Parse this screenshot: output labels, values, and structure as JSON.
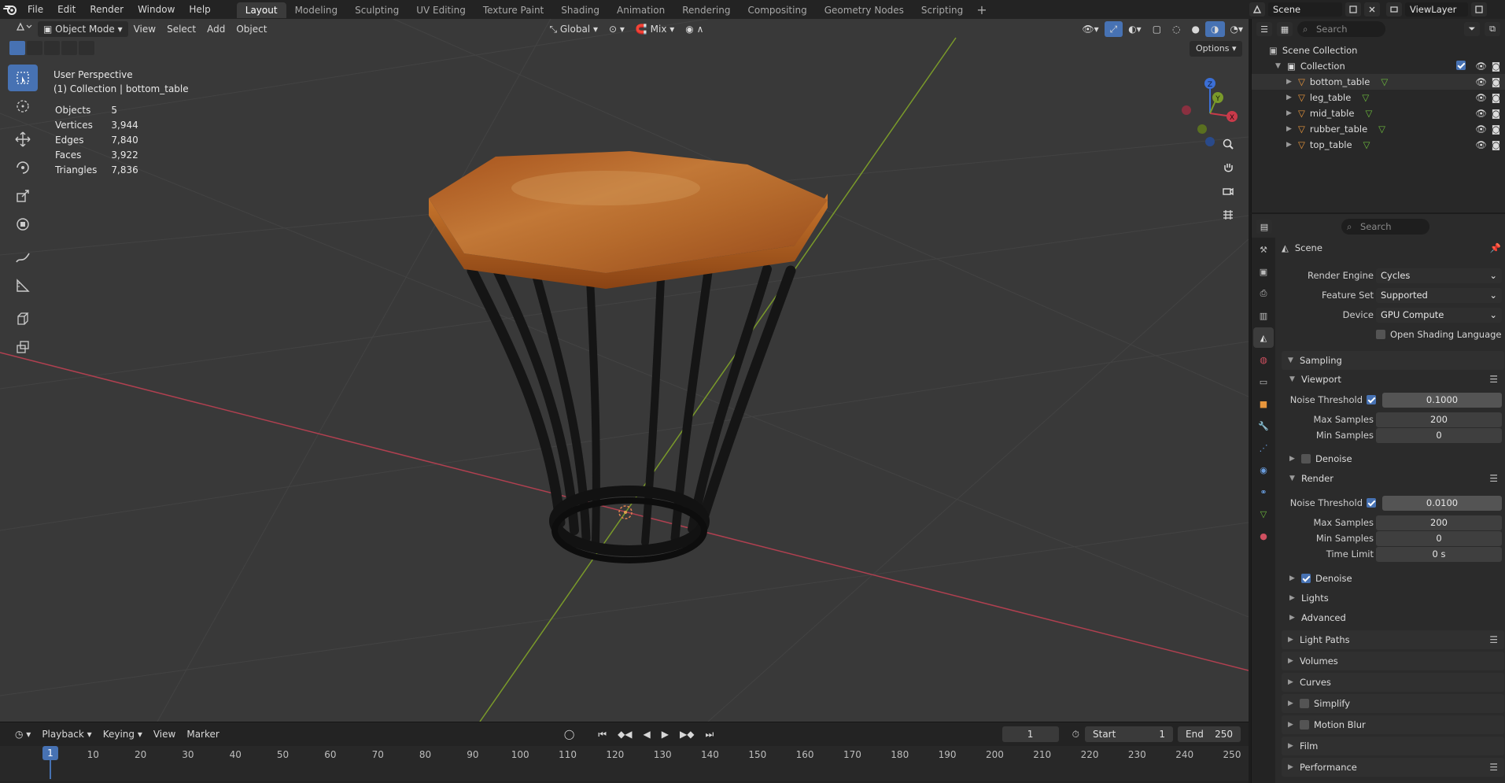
{
  "menu": {
    "items": [
      "File",
      "Edit",
      "Render",
      "Window",
      "Help"
    ]
  },
  "workspaces": {
    "tabs": [
      "Layout",
      "Modeling",
      "Sculpting",
      "UV Editing",
      "Texture Paint",
      "Shading",
      "Animation",
      "Rendering",
      "Compositing",
      "Geometry Nodes",
      "Scripting"
    ],
    "active": "Layout",
    "add": "+"
  },
  "scene": {
    "label": "Scene"
  },
  "viewlayer": {
    "label": "ViewLayer"
  },
  "viewport": {
    "mode": "Object Mode",
    "menus": [
      "View",
      "Select",
      "Add",
      "Object"
    ],
    "orientation": "Global",
    "pivot": "Mix",
    "options": "Options",
    "perspective": "User Perspective",
    "context": "(1) Collection | bottom_table",
    "stats": [
      {
        "label": "Objects",
        "value": "5"
      },
      {
        "label": "Vertices",
        "value": "3,944"
      },
      {
        "label": "Edges",
        "value": "7,840"
      },
      {
        "label": "Faces",
        "value": "3,922"
      },
      {
        "label": "Triangles",
        "value": "7,836"
      }
    ],
    "gizmo": {
      "x": "X",
      "y": "Y",
      "z": "Z"
    }
  },
  "timeline": {
    "menus": [
      "Playback",
      "Keying",
      "View",
      "Marker"
    ],
    "current_frame": "1",
    "start_label": "Start",
    "start": "1",
    "end_label": "End",
    "end": "250",
    "ticks": [
      "1",
      "10",
      "20",
      "30",
      "40",
      "50",
      "60",
      "70",
      "80",
      "90",
      "100",
      "110",
      "120",
      "130",
      "140",
      "150",
      "160",
      "170",
      "180",
      "190",
      "200",
      "210",
      "220",
      "230",
      "240",
      "250"
    ]
  },
  "outliner": {
    "search_placeholder": "Search",
    "scene_collection": "Scene Collection",
    "collection": "Collection",
    "objects": [
      "bottom_table",
      "leg_table",
      "mid_table",
      "rubber_table",
      "top_table"
    ]
  },
  "properties": {
    "search_placeholder": "Search",
    "context": "Scene",
    "render_engine_label": "Render Engine",
    "render_engine": "Cycles",
    "feature_set_label": "Feature Set",
    "feature_set": "Supported",
    "device_label": "Device",
    "device": "GPU Compute",
    "osl_label": "Open Shading Language",
    "sampling": "Sampling",
    "viewport_sub": "Viewport",
    "noise_threshold_label": "Noise Threshold",
    "vp_noise_threshold": "0.1000",
    "max_samples_label": "Max Samples",
    "vp_max_samples": "200",
    "min_samples_label": "Min Samples",
    "vp_min_samples": "0",
    "denoise_label": "Denoise",
    "render_sub": "Render",
    "r_noise_threshold": "0.0100",
    "r_max_samples": "200",
    "r_min_samples": "0",
    "time_limit_label": "Time Limit",
    "r_time_limit": "0 s",
    "lights": "Lights",
    "advanced": "Advanced",
    "light_paths": "Light Paths",
    "volumes": "Volumes",
    "curves": "Curves",
    "simplify": "Simplify",
    "motion_blur": "Motion Blur",
    "film": "Film",
    "performance": "Performance"
  },
  "colors": {
    "accent": "#4772b3",
    "axis_x": "#c93a4a",
    "axis_y": "#7a9a2a",
    "wood": "#b8672a"
  }
}
